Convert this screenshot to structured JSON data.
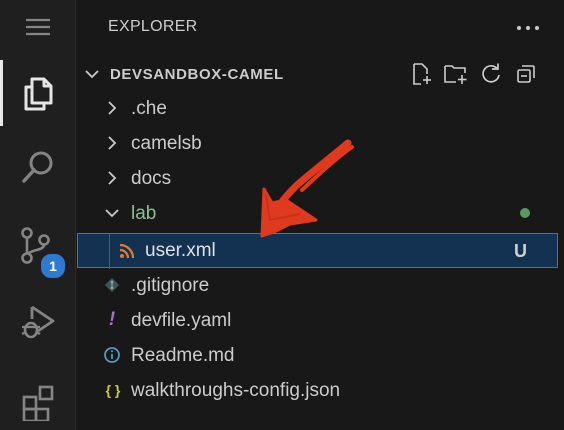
{
  "sidebar": {
    "title": "EXPLORER",
    "section_title": "DEVSANDBOX-CAMEL"
  },
  "activity_bar": {
    "items": [
      {
        "name": "explorer",
        "icon": "files-icon",
        "active": true
      },
      {
        "name": "search",
        "icon": "search-icon",
        "active": false
      },
      {
        "name": "source-control",
        "icon": "source-control-icon",
        "active": false,
        "badge": "1"
      },
      {
        "name": "run-and-debug",
        "icon": "run-debug-icon",
        "active": false
      },
      {
        "name": "extensions",
        "icon": "extensions-icon",
        "active": false
      }
    ]
  },
  "section_actions": [
    "new-file-icon",
    "new-folder-icon",
    "refresh-icon",
    "collapse-all-icon"
  ],
  "tree": [
    {
      "label": ".che",
      "type": "folder",
      "expanded": false
    },
    {
      "label": "camelsb",
      "type": "folder",
      "expanded": false
    },
    {
      "label": "docs",
      "type": "folder",
      "expanded": false
    },
    {
      "label": "lab",
      "type": "folder",
      "expanded": true,
      "status": "modified-dot"
    },
    {
      "label": "user.xml",
      "type": "file",
      "icon": "rss-icon",
      "status": "U",
      "selected": true
    },
    {
      "label": ".gitignore",
      "type": "file",
      "icon": "git-icon"
    },
    {
      "label": "devfile.yaml",
      "type": "file",
      "icon": "exclamation-icon"
    },
    {
      "label": "Readme.md",
      "type": "file",
      "icon": "info-icon"
    },
    {
      "label": "walkthroughs-config.json",
      "type": "file",
      "icon": "json-braces-icon",
      "icon_text": "{ }"
    }
  ],
  "colors": {
    "background": "#181818",
    "activity_bar": "#1f1f1f",
    "text": "#cccccc",
    "selection_bg": "#133252",
    "selection_border": "#2b79d0",
    "lab_folder": "#86c28f",
    "badge": "#2f7ad1",
    "annotation_arrow": "#e03a1e"
  }
}
